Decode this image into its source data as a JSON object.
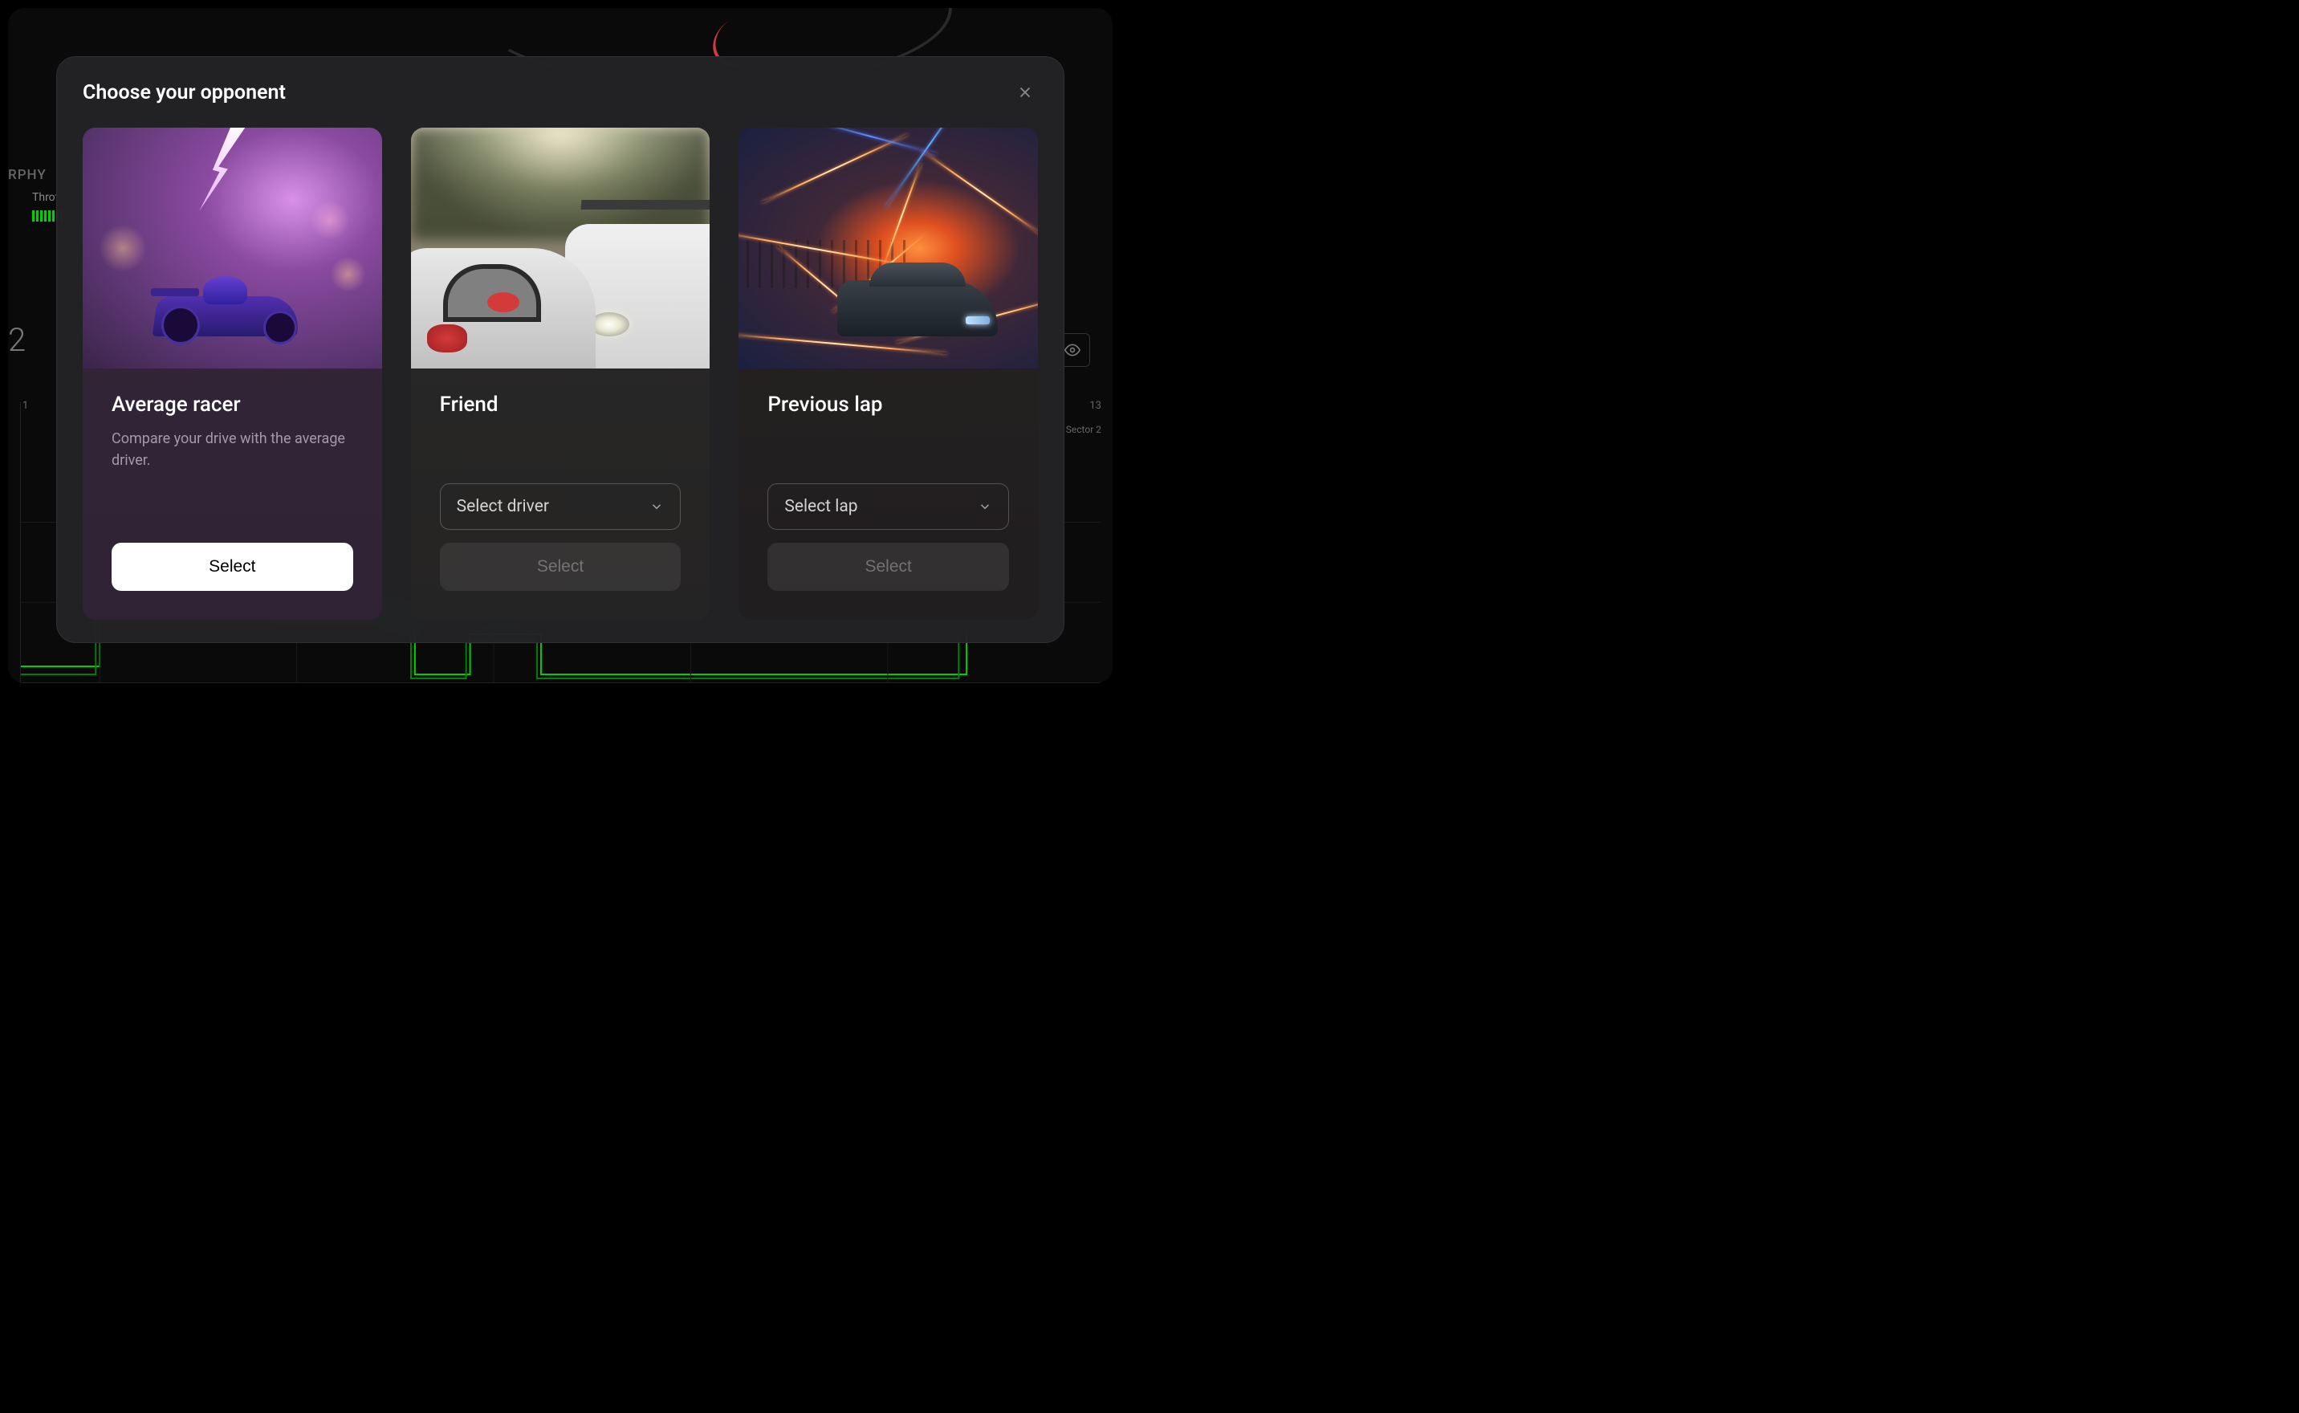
{
  "background": {
    "label_partial": "RPHY",
    "throttle_label": "Throt",
    "number_partial": "2",
    "tick_1": "1",
    "sector_number": "13",
    "sector_label": "Sector 2"
  },
  "modal": {
    "title": "Choose your opponent",
    "cards": [
      {
        "title": "Average racer",
        "description": "Compare your drive with the average driver.",
        "select_label": "Select"
      },
      {
        "title": "Friend",
        "dropdown_label": "Select driver",
        "select_label": "Select"
      },
      {
        "title": "Previous lap",
        "dropdown_label": "Select lap",
        "select_label": "Select"
      }
    ]
  }
}
